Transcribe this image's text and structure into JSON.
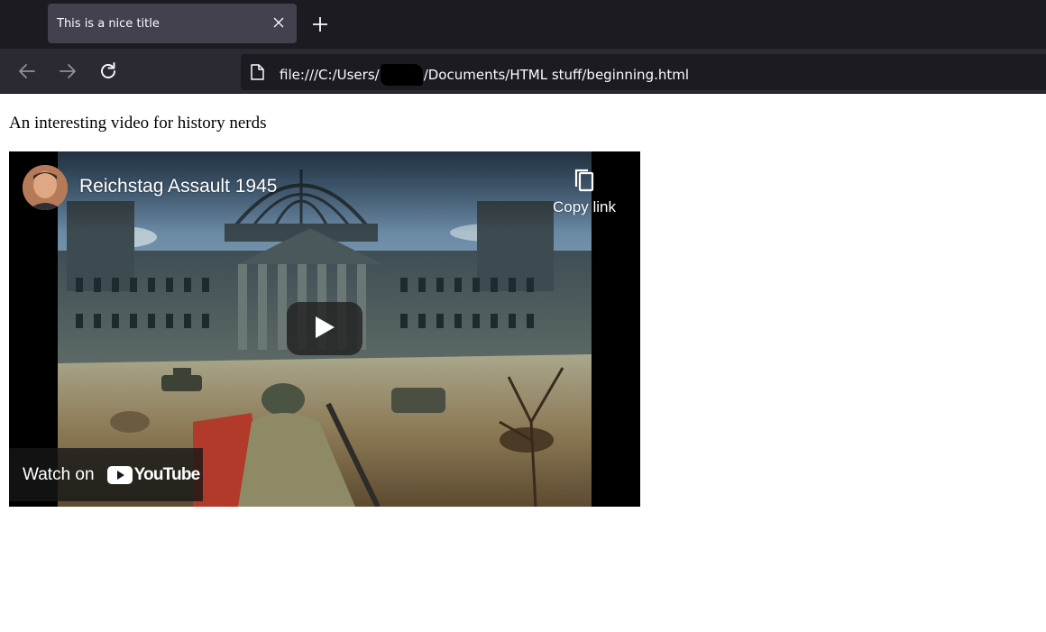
{
  "browser": {
    "tab": {
      "title": "This is a nice title",
      "close_icon": "close-icon"
    },
    "new_tab_icon": "plus-icon",
    "nav": {
      "back_icon": "arrow-left-icon",
      "forward_icon": "arrow-right-icon",
      "reload_icon": "reload-icon"
    },
    "url": {
      "page_icon": "page-icon",
      "prefix": "file:///C:/Users/",
      "suffix": "/Documents/HTML stuff/beginning.html"
    }
  },
  "page": {
    "heading": "An interesting video for history nerds",
    "video": {
      "title": "Reichstag Assault 1945",
      "copy_link_label": "Copy link",
      "copy_icon": "copy-icon",
      "play_icon": "play-icon",
      "watch_on_label": "Watch on",
      "youtube_label": "YouTube"
    }
  },
  "colors": {
    "tabstrip_bg": "#1c1b22",
    "active_tab_bg": "#42414d",
    "navbar_bg": "#2b2a33",
    "urlbar_bg": "#1c1b22",
    "youtube_red": "#ff0000"
  }
}
